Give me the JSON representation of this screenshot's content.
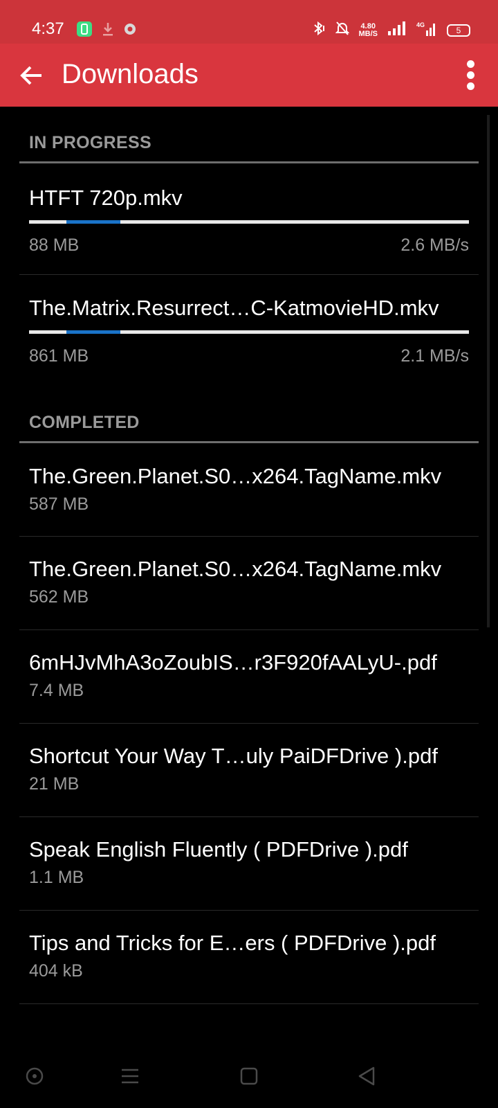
{
  "status_bar": {
    "time": "4:37",
    "net_speed_value": "4.80",
    "net_speed_unit": "MB/S",
    "network": "4G",
    "battery": "5",
    "icons": [
      "notification-app-icon",
      "download-icon",
      "record-icon",
      "bluetooth-icon",
      "mute-icon",
      "signal-icon",
      "signal-4g-icon",
      "battery-icon"
    ]
  },
  "app_bar": {
    "title": "Downloads",
    "back_icon": "arrow-left-icon",
    "menu_icon": "more-vert-icon"
  },
  "in_progress": {
    "header": "IN PROGRESS",
    "items": [
      {
        "name": "HTFT 720p.mkv",
        "size": "88 MB",
        "speed": "2.6 MB/s"
      },
      {
        "name": "The.Matrix.Resurrect…C-KatmovieHD.mkv",
        "size": "861 MB",
        "speed": "2.1 MB/s"
      }
    ]
  },
  "completed": {
    "header": "COMPLETED",
    "items": [
      {
        "name": "The.Green.Planet.S0…x264.TagName.mkv",
        "size": "587 MB"
      },
      {
        "name": "The.Green.Planet.S0…x264.TagName.mkv",
        "size": "562 MB"
      },
      {
        "name": "6mHJvMhA3oZoubIS…r3F920fAALyU-.pdf",
        "size": "7.4 MB"
      },
      {
        "name": "Shortcut Your Way T…uly PaiDFDrive ).pdf",
        "size": "21 MB"
      },
      {
        "name": "Speak English Fluently ( PDFDrive ).pdf",
        "size": "1.1 MB"
      },
      {
        "name": "Tips and Tricks for E…ers ( PDFDrive ).pdf",
        "size": "404 kB"
      }
    ]
  },
  "nav_bar": {
    "icons": [
      "assistant-icon",
      "recents-menu-icon",
      "home-square-icon",
      "back-triangle-icon"
    ]
  },
  "colors": {
    "status_bar": "#cc343a",
    "app_bar": "#d9363e",
    "progress_fill": "#1a73c8"
  }
}
